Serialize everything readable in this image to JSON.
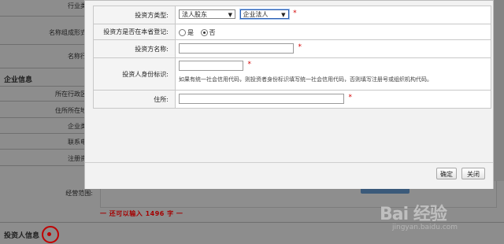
{
  "background": {
    "labels": [
      "行业类",
      "名称组成形式",
      "名称行",
      "所在行政区",
      "住所所在地",
      "企业类",
      "联系电",
      "注册资",
      "经营范围:"
    ],
    "section_enterprise": "企业信息",
    "section_investor": "投资人信息",
    "remaining_chars": "一 还可以输入 1496 字 一",
    "watermark": "Bai 经验",
    "watermark_sub": "jingyan.baidu.com"
  },
  "modal": {
    "rows": {
      "investor_type_label": "投资方类型:",
      "investor_type_value": "法人股东",
      "investor_subtype_value": "企业法人",
      "registered_label": "投资方是否在本省登记:",
      "radio_yes": "是",
      "radio_no": "否",
      "investor_name_label": "投资方名称:",
      "id_label": "投资人身份标识:",
      "id_hint": "如果有统一社会信用代码，则投资者身份标识填写统一社会信用代码，否则填写注册号或组织机构代码。",
      "address_label": "住所:"
    },
    "required_mark": "*",
    "buttons": {
      "confirm": "确定",
      "close": "关闭"
    }
  }
}
